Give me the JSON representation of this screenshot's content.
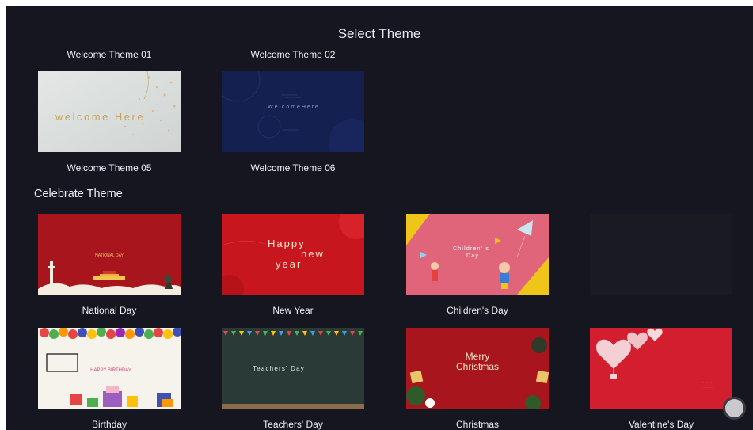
{
  "header": {
    "title": "Select Theme"
  },
  "welcome_section": {
    "top_labels": [
      "Welcome Theme 01",
      "Welcome Theme 02"
    ],
    "themes": [
      {
        "label": "Welcome Theme 05",
        "thumb_text": "welcome Here"
      },
      {
        "label": "Welcome Theme 06",
        "thumb_text": "W e l c o m e H e r e"
      }
    ]
  },
  "celebrate_section": {
    "title": "Celebrate Theme",
    "themes": [
      {
        "label": "National Day",
        "thumb_text": "NATIONAL DAY"
      },
      {
        "label": "New Year",
        "thumb_line1": "Happy",
        "thumb_line2": "new",
        "thumb_line3": "year"
      },
      {
        "label": "Children's Day",
        "thumb_line1": "Children' s",
        "thumb_line2": "Day"
      },
      {
        "label": "Birthday",
        "thumb_text": "HAPPY BIRTHDAY"
      },
      {
        "label": "Teachers' Day",
        "thumb_text": "Teachers'  Day"
      },
      {
        "label": "Christmas",
        "thumb_line1": "Merry",
        "thumb_line2": "Christmas"
      },
      {
        "label": "Valentine's Day"
      }
    ]
  },
  "colors": {
    "background": "#161620",
    "text": "#f0f0f4",
    "fab": "#c9c9ce"
  },
  "icons": {
    "floating_button": "circle-fab-icon"
  }
}
